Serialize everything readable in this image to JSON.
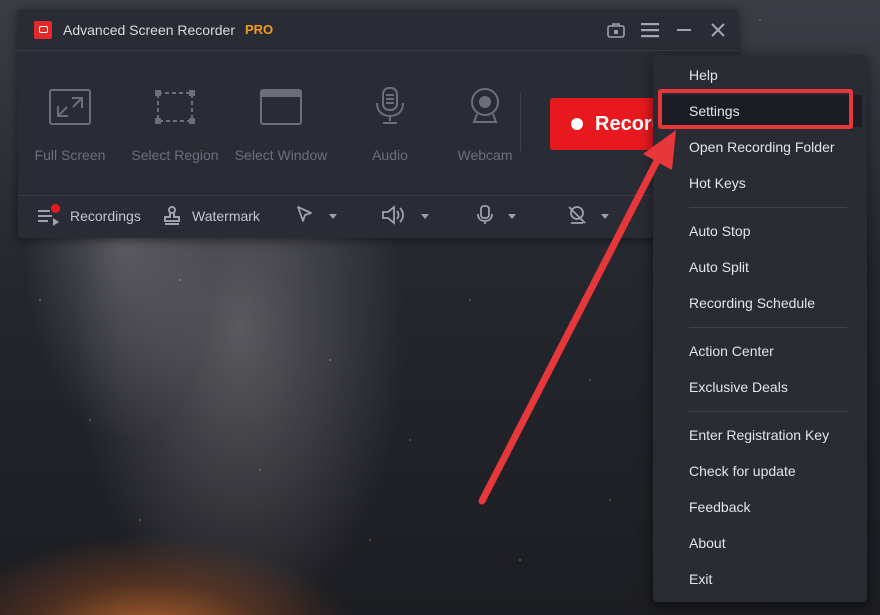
{
  "app": {
    "title": "Advanced Screen Recorder",
    "badge": "PRO",
    "colors": {
      "accent": "#e8191e",
      "pro": "#f39a1e",
      "window_bg": "#2a2c35"
    }
  },
  "titlebar_icons": [
    "briefcase-lock-icon",
    "hamburger-menu-icon",
    "minimize-icon",
    "close-icon"
  ],
  "modes": [
    {
      "label": "Full Screen",
      "icon": "fullscreen-icon"
    },
    {
      "label": "Select Region",
      "icon": "select-region-icon"
    },
    {
      "label": "Select Window",
      "icon": "select-window-icon"
    },
    {
      "label": "Audio",
      "icon": "microphone-icon"
    },
    {
      "label": "Webcam",
      "icon": "webcam-icon"
    }
  ],
  "record_button": {
    "label": "Record"
  },
  "bottom_bar": {
    "recordings_label": "Recordings",
    "watermark_label": "Watermark",
    "dropdowns": [
      "cursor-icon",
      "speaker-icon",
      "microphone-icon",
      "webcam-off-icon"
    ]
  },
  "menu": {
    "items": [
      "Help",
      "Settings",
      "Open Recording Folder",
      "Hot Keys",
      "Auto Stop",
      "Auto Split",
      "Recording Schedule",
      "Action Center",
      "Exclusive Deals",
      "Enter Registration Key",
      "Check for update",
      "Feedback",
      "About",
      "Exit"
    ],
    "highlighted_item": "Settings"
  },
  "annotation": {
    "color": "#e8373b"
  }
}
